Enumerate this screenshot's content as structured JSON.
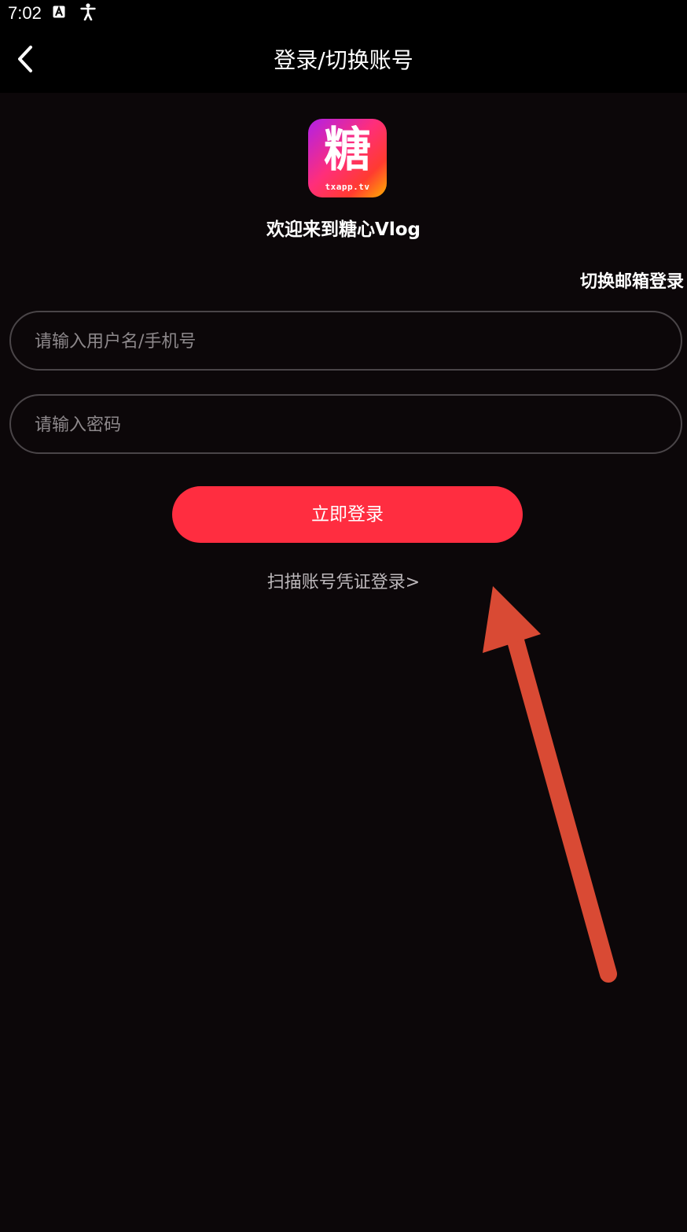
{
  "status_bar": {
    "time": "7:02",
    "icons": [
      "text-a-icon",
      "accessibility-icon"
    ]
  },
  "nav": {
    "back_icon": "chevron-left-icon",
    "title": "登录/切换账号"
  },
  "logo": {
    "glyph": "糖",
    "url": "txapp.tv",
    "colors": [
      "#b020e8",
      "#ff2e7a",
      "#ff3b30",
      "#ffb000"
    ]
  },
  "welcome": "欢迎来到糖心Vlog",
  "switch_email_label": "切换邮箱登录",
  "form": {
    "username_placeholder": "请输入用户名/手机号",
    "username_value": "",
    "password_placeholder": "请输入密码",
    "password_value": ""
  },
  "login_button_label": "立即登录",
  "scan_login_label": "扫描账号凭证登录>",
  "colors": {
    "background": "#0c0709",
    "accent": "#ff2d40",
    "annotation_arrow": "#d94a34"
  }
}
